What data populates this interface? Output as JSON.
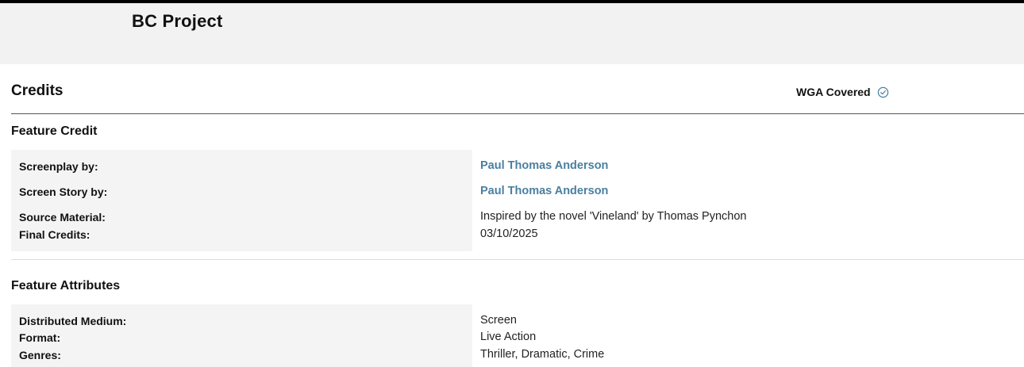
{
  "header": {
    "project_title": "BC Project"
  },
  "credits": {
    "title": "Credits",
    "wga_label": "WGA Covered",
    "wga_icon": "check-circle-icon"
  },
  "feature_credit": {
    "title": "Feature Credit",
    "rows": [
      {
        "label": "Screenplay by:",
        "value": "Paul Thomas Anderson"
      },
      {
        "label": "Screen Story by:",
        "value": "Paul Thomas Anderson"
      },
      {
        "label": "Source Material:",
        "value": "Inspired by the novel 'Vineland' by Thomas Pynchon"
      },
      {
        "label": "Final Credits:",
        "value": "03/10/2025"
      }
    ]
  },
  "feature_attributes": {
    "title": "Feature Attributes",
    "rows": [
      {
        "label": "Distributed Medium:",
        "value": "Screen"
      },
      {
        "label": "Format:",
        "value": "Live Action"
      },
      {
        "label": "Genres:",
        "value": "Thriller, Dramatic, Crime"
      }
    ]
  },
  "colors": {
    "link": "#4a7fa0",
    "panel": "#f4f4f4",
    "header_bg": "#f2f2f2"
  }
}
